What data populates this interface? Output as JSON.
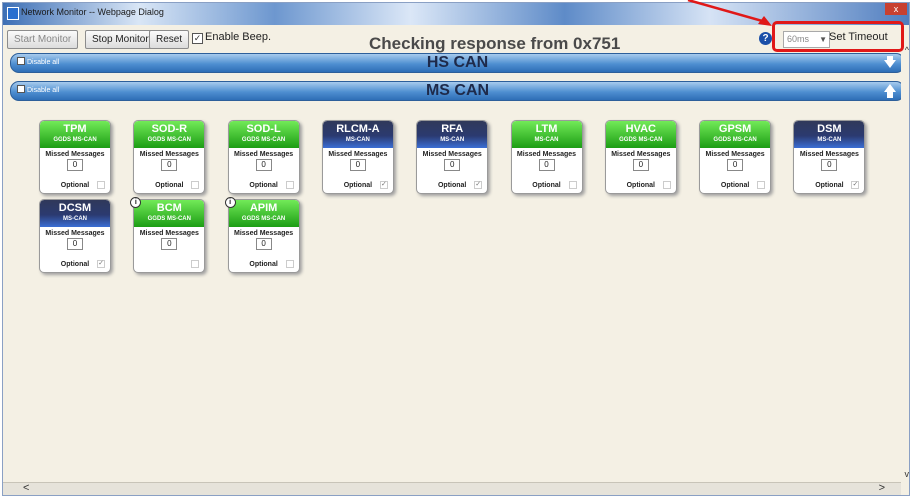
{
  "window": {
    "title": "Network Monitor -- Webpage Dialog",
    "close_label": "x"
  },
  "toolbar": {
    "start_label": "Start Monitor",
    "stop_label": "Stop Monitor",
    "reset_label": "Reset",
    "beep_label": "Enable Beep.",
    "beep_checked": "✓",
    "status_text": "Checking response from 0x751",
    "help_label": "?",
    "timeout_value": "60ms",
    "set_timeout_label": "Set Timeout"
  },
  "sections": [
    {
      "title": "HS CAN",
      "disable_label": "Disable all",
      "arrow": "down"
    },
    {
      "title": "MS CAN",
      "disable_label": "Disable all",
      "arrow": "up"
    }
  ],
  "modules": [
    {
      "name": "TPM",
      "bus": "GGDS MS-CAN",
      "color": "green",
      "missed_label": "Missed Messages",
      "count": "0",
      "optional_label": "Optional",
      "optional_checked": "",
      "info": ""
    },
    {
      "name": "SOD-R",
      "bus": "GGDS MS-CAN",
      "color": "green",
      "missed_label": "Missed Messages",
      "count": "0",
      "optional_label": "Optional",
      "optional_checked": "",
      "info": ""
    },
    {
      "name": "SOD-L",
      "bus": "GGDS MS-CAN",
      "color": "green",
      "missed_label": "Missed Messages",
      "count": "0",
      "optional_label": "Optional",
      "optional_checked": "",
      "info": ""
    },
    {
      "name": "RLCM-A",
      "bus": "MS-CAN",
      "color": "blue",
      "missed_label": "Missed Messages",
      "count": "0",
      "optional_label": "Optional",
      "optional_checked": "✓",
      "info": ""
    },
    {
      "name": "RFA",
      "bus": "MS-CAN",
      "color": "blue",
      "missed_label": "Missed Messages",
      "count": "0",
      "optional_label": "Optional",
      "optional_checked": "✓",
      "info": ""
    },
    {
      "name": "LTM",
      "bus": "MS-CAN",
      "color": "green",
      "missed_label": "Missed Messages",
      "count": "0",
      "optional_label": "Optional",
      "optional_checked": "",
      "info": ""
    },
    {
      "name": "HVAC",
      "bus": "GGDS MS-CAN",
      "color": "green",
      "missed_label": "Missed Messages",
      "count": "0",
      "optional_label": "Optional",
      "optional_checked": "",
      "info": ""
    },
    {
      "name": "GPSM",
      "bus": "GGDS MS-CAN",
      "color": "green",
      "missed_label": "Missed Messages",
      "count": "0",
      "optional_label": "Optional",
      "optional_checked": "",
      "info": ""
    },
    {
      "name": "DSM",
      "bus": "MS-CAN",
      "color": "blue",
      "missed_label": "Missed Messages",
      "count": "0",
      "optional_label": "Optional",
      "optional_checked": "✓",
      "info": ""
    },
    {
      "name": "DCSM",
      "bus": "MS-CAN",
      "color": "blue",
      "missed_label": "Missed Messages",
      "count": "0",
      "optional_label": "Optional",
      "optional_checked": "✓",
      "info": ""
    },
    {
      "name": "BCM",
      "bus": "GGDS MS-CAN",
      "color": "green",
      "missed_label": "Missed Messages",
      "count": "0",
      "optional_label": "",
      "optional_checked": "",
      "info": "i"
    },
    {
      "name": "APIM",
      "bus": "GGDS MS-CAN",
      "color": "green",
      "missed_label": "Missed Messages",
      "count": "0",
      "optional_label": "Optional",
      "optional_checked": "",
      "info": "i"
    }
  ],
  "scroll": {
    "left": "<",
    "right": ">",
    "up": "^",
    "down": "v"
  },
  "colors": {
    "accent_blue": "#2e6eb6",
    "module_green": "#1c9d14",
    "module_blue": "#2b3a70",
    "highlight_red": "#e01818"
  }
}
